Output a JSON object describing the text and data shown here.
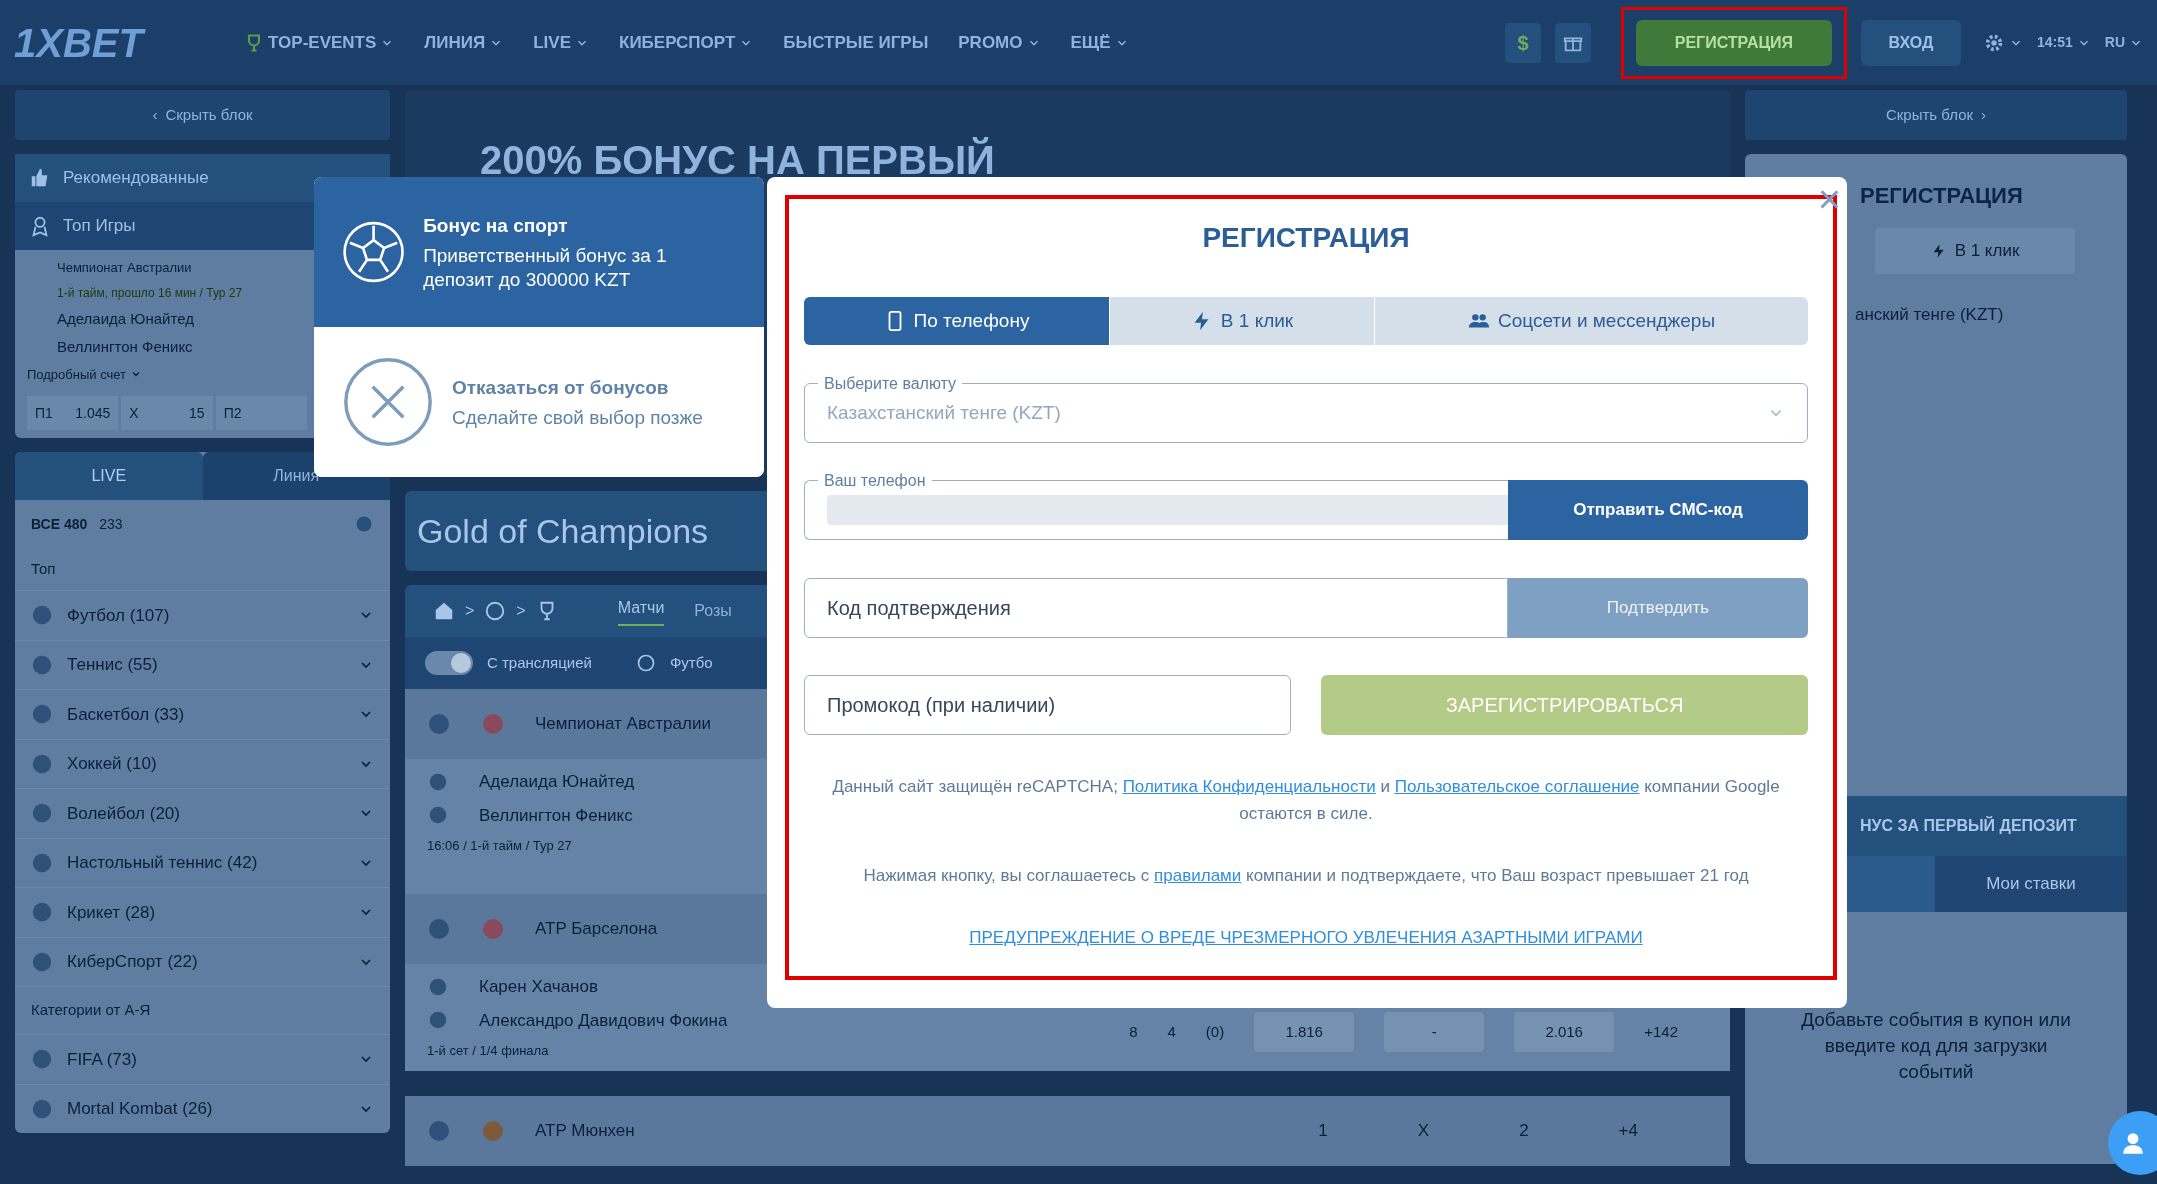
{
  "header": {
    "logo": "1XBET",
    "nav": [
      {
        "label": "TOP-EVENTS",
        "has_menu": true
      },
      {
        "label": "ЛИНИЯ",
        "has_menu": true
      },
      {
        "label": "LIVE",
        "has_menu": true
      },
      {
        "label": "КИБЕРСПОРТ",
        "has_menu": true
      },
      {
        "label": "БЫСТРЫЕ ИГРЫ",
        "has_menu": false
      },
      {
        "label": "PROMO",
        "has_menu": true
      },
      {
        "label": "ЕЩЁ",
        "has_menu": true
      }
    ],
    "dollar": "$",
    "register": "РЕГИСТРАЦИЯ",
    "login": "ВХОД",
    "time": "14:51",
    "lang": "RU"
  },
  "left_sidebar": {
    "hide_arrow": "‹",
    "hide": "Скрыть блок",
    "menu": [
      "Рекомендованные",
      "Топ Игры"
    ],
    "featured": {
      "league": "Чемпионат Австралии",
      "status": "1-й тайм, прошло 16 мин / Тур 27",
      "teams": [
        "Аделаида Юнайтед",
        "Веллингтон Феникс"
      ],
      "details": "Подробный счет",
      "odds": [
        {
          "label": "П1",
          "value": "1.045"
        },
        {
          "label": "X",
          "value": "15"
        },
        {
          "label": "П2"
        }
      ]
    },
    "tabs": [
      {
        "label": "LIVE",
        "selected": true
      },
      {
        "label": "Линия",
        "selected": false
      }
    ],
    "all": "ВСЕ 480",
    "all_count": "233",
    "top": "Топ",
    "sports": [
      {
        "label": "Футбол (107)"
      },
      {
        "label": "Теннис (55)"
      },
      {
        "label": "Баскетбол (33)"
      },
      {
        "label": "Хоккей (10)"
      },
      {
        "label": "Волейбол (20)"
      },
      {
        "label": "Настольный теннис (42)"
      },
      {
        "label": "Крикет (28)"
      },
      {
        "label": "КиберСпорт (22)"
      }
    ],
    "category": "Категории от А-Я",
    "more_sports": [
      {
        "label": "FIFA (73)"
      },
      {
        "label": "Mortal Kombat (26)"
      }
    ]
  },
  "center": {
    "banner": "200% БОНУС НА ПЕРВЫЙ",
    "title": "Gold of Champions",
    "separators": [
      ">",
      ">"
    ],
    "tab": "Матчи",
    "tab_cut": "Розы",
    "toggle": "С трансляцией",
    "toggle_on": true,
    "sport": "Футбо",
    "matches": [
      {
        "league": "Чемпионат Австралии",
        "teams": [
          "Аделаида Юнайтед",
          "Веллингтон Феникс"
        ],
        "info": "16:06 / 1-й тайм / Тур 27"
      },
      {
        "league": "ATP Барселона",
        "teams": [
          "Карен Хачанов",
          "Александро Давидович Фокина"
        ],
        "info": "1-й сет / 1/4 финала",
        "score": [
          "8",
          "4",
          "(0)"
        ],
        "odds": [
          "1.816",
          "-",
          "2.016"
        ],
        "more": "+142"
      }
    ],
    "next_league": "ATP Мюнхен",
    "next_odds": [
      "1",
      "X",
      "2"
    ],
    "next_more": "+4"
  },
  "right_sidebar": {
    "hide": "Скрыть блок",
    "hide_arrow": "›",
    "title": "РЕГИСТРАЦИЯ",
    "tab": "В 1 клик",
    "currency": "анский тенге (KZT)",
    "bonus_bar": "НУС ЗА ПЕРВЫЙ ДЕПОЗИТ",
    "bets_tab": "Мои ставки",
    "empty": "Добавьте события в купон или введите код для загрузки событий"
  },
  "bonus_choice": [
    {
      "title": "Бонус на спорт",
      "text": "Приветственный бонус за 1 депозит до 300000 KZT",
      "kind": "ball",
      "selected": true
    },
    {
      "title": "Отказаться от бонусов",
      "text": "Сделайте свой выбор позже",
      "kind": "cross",
      "selected": false
    }
  ],
  "modal": {
    "title": "РЕГИСТРАЦИЯ",
    "close": "×",
    "tabs": [
      {
        "label": "По телефону",
        "selected": true
      },
      {
        "label": "В 1 клик",
        "selected": false
      },
      {
        "label": "Соцсети и мессенджеры",
        "selected": false
      }
    ],
    "currency": {
      "label": "Выберите валюту",
      "value": "Казахстанский тенге (KZT)"
    },
    "phone": {
      "label": "Ваш телефон",
      "button": "Отправить СМС-код"
    },
    "code": {
      "placeholder": "Код подтверждения",
      "button": "Подтвердить",
      "disabled": true
    },
    "promo": {
      "placeholder": "Промокод (при наличии)"
    },
    "submit": "ЗАРЕГИСТРИРОВАТЬСЯ",
    "recaptcha": {
      "before": "Данный сайт защищён reCAPTCHA;",
      "link1": "Политика Конфиденциальности",
      "mid": "и",
      "link2": "Пользовательское соглашение",
      "after": "компании Google остаются в силе."
    },
    "rules": {
      "before": "Нажимая кнопку, вы соглашаетесь с",
      "link": "правилами",
      "after": "компании и подтверждаете, что Ваш возраст превышает 21 год"
    },
    "warning": "ПРЕДУПРЕЖДЕНИЕ О ВРЕДЕ ЧРЕЗМЕРНОГО УВЛЕЧЕНИЯ АЗАРТНЫМИ ИГРАМИ"
  }
}
